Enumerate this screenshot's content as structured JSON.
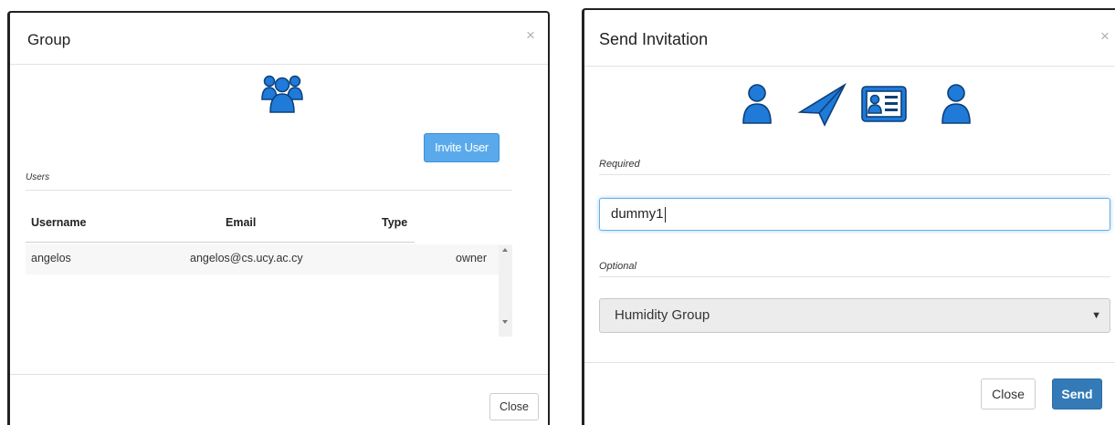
{
  "group_modal": {
    "title": "Group",
    "close_symbol": "×",
    "header_icon": "group-users-icon",
    "invite_button_label": "Invite User",
    "users_section_label": "Users",
    "table": {
      "columns": [
        "Username",
        "Email",
        "Type"
      ],
      "rows": [
        {
          "username": "angelos",
          "email": "angelos@cs.ucy.ac.cy",
          "type": "owner"
        }
      ]
    },
    "close_button_label": "Close"
  },
  "invitation_modal": {
    "title": "Send Invitation",
    "close_symbol": "×",
    "header_icons": [
      "user-icon",
      "paper-plane-icon",
      "id-card-icon",
      "user-icon"
    ],
    "required_label": "Required",
    "username_value": "dummy1",
    "optional_label": "Optional",
    "group_select_value": "Humidity Group",
    "select_arrow_symbol": "▼",
    "close_button_label": "Close",
    "send_button_label": "Send"
  },
  "colors": {
    "icon_blue": "#1f7ad8",
    "invite_button": "#5aaaeb",
    "send_button": "#337ab7",
    "input_focus": "#66afe9"
  }
}
